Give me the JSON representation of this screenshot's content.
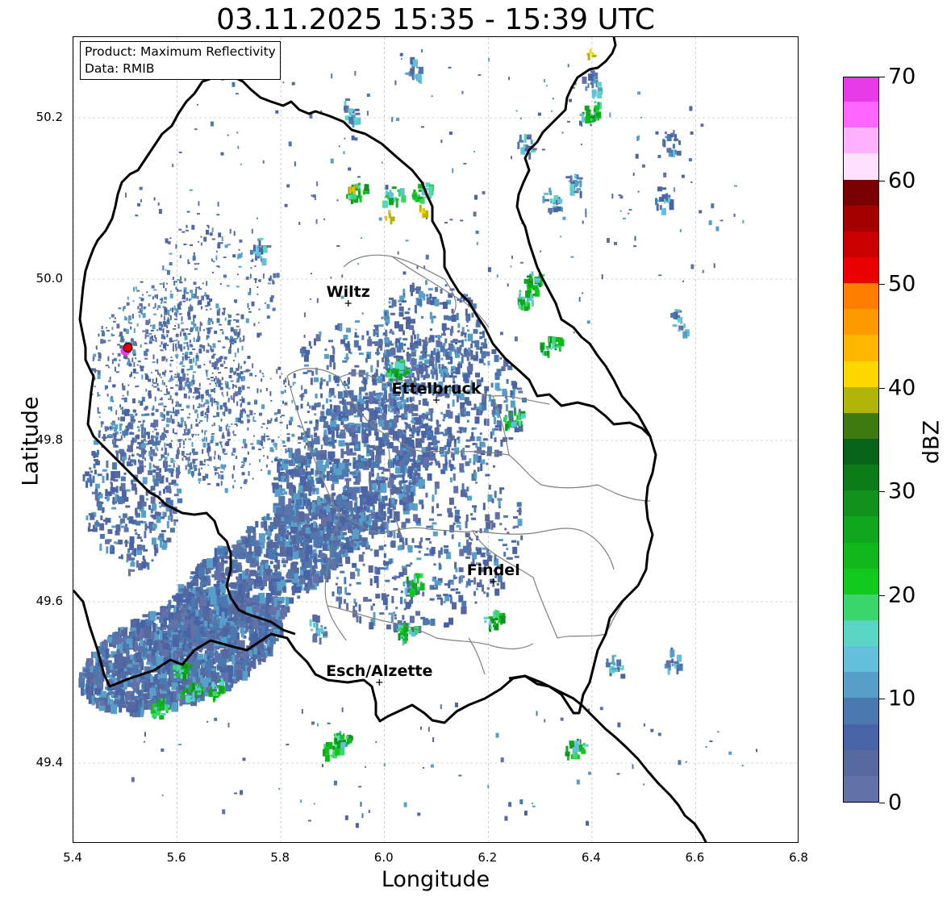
{
  "title": "03.11.2025 15:35 - 15:39 UTC",
  "info_box": {
    "product": "Product: Maximum Reflectivity",
    "data_source": "Data: RMIB"
  },
  "axes": {
    "xlabel": "Longitude",
    "ylabel": "Latitude",
    "xlim": [
      5.4,
      6.8
    ],
    "ylim": [
      49.3,
      50.3
    ],
    "xticks": [
      "5.4",
      "5.6",
      "5.8",
      "6.0",
      "6.2",
      "6.4",
      "6.6",
      "6.8"
    ],
    "yticks": [
      "49.4",
      "49.6",
      "49.8",
      "50.0",
      "50.2"
    ],
    "grid": true
  },
  "colorbar": {
    "label": "dBZ",
    "ticks": [
      "0",
      "10",
      "20",
      "30",
      "40",
      "50",
      "60",
      "70"
    ],
    "range": [
      0,
      70
    ],
    "colors": [
      "#6272a8",
      "#56699f",
      "#4863a6",
      "#4b79af",
      "#579fc8",
      "#64bfdc",
      "#5ad5c4",
      "#3ad66b",
      "#10c91c",
      "#10b81c",
      "#0fa51c",
      "#0e921c",
      "#0b7b17",
      "#07621a",
      "#3f7a10",
      "#b0b508",
      "#ffd800",
      "#ffb600",
      "#ff9900",
      "#ff7d00",
      "#ea0000",
      "#c90000",
      "#a50000",
      "#780000",
      "#ffe0ff",
      "#ffb0ff",
      "#ff66ff",
      "#e83be8"
    ]
  },
  "cities": [
    {
      "name": "Wiltz",
      "lon": 5.93,
      "lat": 49.97
    },
    {
      "name": "Ettelbruck",
      "lon": 6.1,
      "lat": 49.85
    },
    {
      "name": "Findel",
      "lon": 6.21,
      "lat": 49.625
    },
    {
      "name": "Esch/Alzette",
      "lon": 5.99,
      "lat": 49.5
    }
  ],
  "radar_site": {
    "lon": 5.505,
    "lat": 49.915
  },
  "border_color": "#000000",
  "canton_color": "#808080"
}
